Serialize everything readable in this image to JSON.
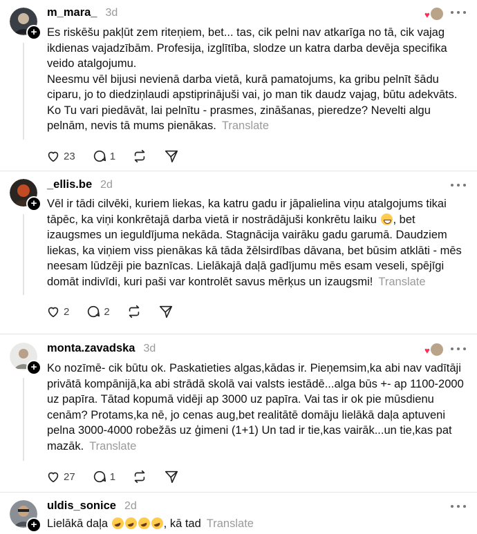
{
  "actions_labels": {
    "translate": "Translate"
  },
  "posts": [
    {
      "username": "m_mara_",
      "time": "3d",
      "has_liker_badge": true,
      "paragraphs": [
        "Es riskēšu pakļūt zem riteņiem, bet... tas, cik pelni nav atkarīga no tā, cik vajag ikdienas vajadzībām. Profesija, izglītība, slodze un katra darba devēja specifika veido atalgojumu.",
        "Neesmu vēl bijusi nevienā darba vietā, kurā pamatojums, ka gribu pelnīt šādu ciparu, jo to diedziņlaudi apstiprinājuši vai, jo man tik daudz vajag, būtu adekvāts. Ko Tu vari piedāvāt, lai pelnītu - prasmes, zināšanas, pieredze? Nevelti algu pelnām, nevis tā mums pienākas."
      ],
      "likes": "23",
      "replies": "1"
    },
    {
      "username": "_ellis.be",
      "time": "2d",
      "has_liker_badge": false,
      "text_before_emoji": "Vēl ir tādi cilvēki, kuriem liekas, ka katru gadu ir jāpalielina viņu atalgojums tikai tāpēc, ka viņi konkrētajā darba vietā ir nostrādājuši konkrētu laiku",
      "text_after_emoji": ", bet izaugsmes un ieguldījuma nekāda. Stagnācija vairāku gadu garumā. Daudziem liekas, ka viņiem viss pienākas kā tāda žēlsirdības dāvana, bet būsim atklāti - mēs neesam lūdzēji pie baznīcas. Lielākajā daļā gadījumu mēs esam veseli, spējīgi domāt indivīdi, kuri paši var kontrolēt savus mērķus un izaugsmi!",
      "likes": "2",
      "replies": "2"
    },
    {
      "username": "monta.zavadska",
      "time": "3d",
      "has_liker_badge": true,
      "text": "Ko nozīmē- cik būtu ok. Paskatieties algas,kādas ir. Pieņemsim,ka abi nav vadītāji privātā kompānijā,ka abi strādā skolā vai valsts iestādē...alga būs +- ap 1100-2000 uz papīra. Tātad kopumā vidēji ap 3000 uz papīra. Vai tas ir ok pie mūsdienu cenām? Protams,ka nē, jo cenas aug,bet realitātē domāju lielākā daļa aptuveni pelna 3000-4000 robežās uz ģimeni (1+1) Un tad ir tie,kas vairāk...un tie,kas pat mazāk.",
      "likes": "27",
      "replies": "1"
    },
    {
      "username": "uldis_sonice",
      "time": "2d",
      "has_liker_badge": false,
      "text_before_emoji": "Lielākā daļa",
      "text_after_emoji": ", kā tad"
    }
  ]
}
